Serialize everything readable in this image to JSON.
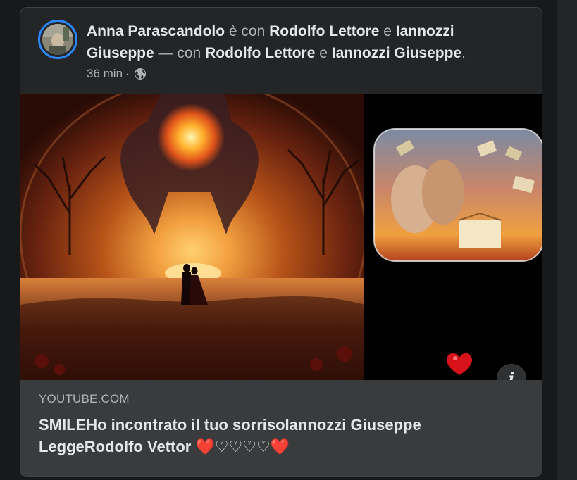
{
  "post": {
    "author": "Anna Parascandolo",
    "with_word": " è con ",
    "tag1": "Rodolfo Lettore",
    "and_word": " e ",
    "tag2": "Iannozzi Giuseppe",
    "dash_with": " — con ",
    "tag3": "Rodolfo Lettore",
    "and_word2": " e ",
    "tag4": "Iannozzi Giuseppe",
    "period": ".",
    "time": "36 min",
    "separator": "·",
    "privacy_icon": "globe-icon"
  },
  "media": {
    "info_label": "i"
  },
  "link": {
    "domain": "YOUTUBE.COM",
    "title": "SMILEHo incontrato il tuo sorrisoIannozzi Giuseppe LeggeRodolfo Vettor ",
    "emoji_start": "❤️",
    "emoji_middle": "♡♡♡♡",
    "emoji_end": "❤️"
  },
  "colors": {
    "background": "#18191a",
    "card": "#242526",
    "link_box": "#3a3b3c",
    "accent_ring": "#2d88ff",
    "text_primary": "#e4e6eb",
    "text_secondary": "#b0b3b8",
    "heart_red": "#e41e3f"
  }
}
